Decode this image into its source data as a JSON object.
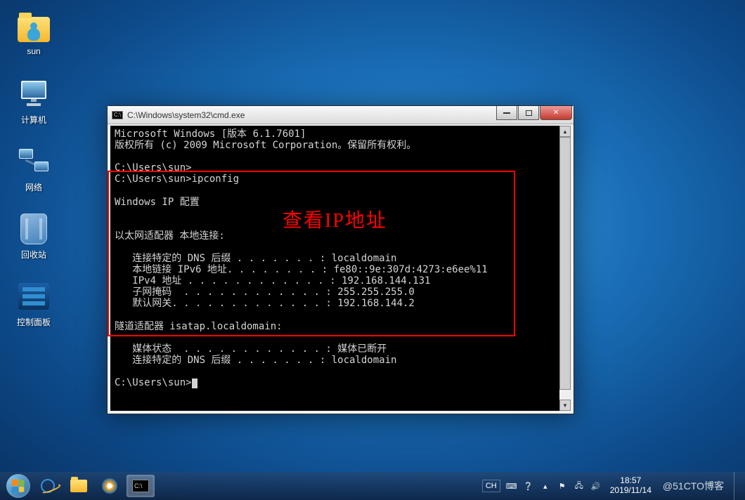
{
  "desktop": {
    "icons": [
      {
        "label": "sun"
      },
      {
        "label": "计算机"
      },
      {
        "label": "网络"
      },
      {
        "label": "回收站"
      },
      {
        "label": "控制面板"
      }
    ]
  },
  "cmd": {
    "title": "C:\\Windows\\system32\\cmd.exe",
    "icon_text": "C:\\",
    "lines": {
      "l1": "Microsoft Windows [版本 6.1.7601]",
      "l2": "版权所有 (c) 2009 Microsoft Corporation。保留所有权利。",
      "l3": "C:\\Users\\sun>",
      "l4": "C:\\Users\\sun>ipconfig",
      "l5": "Windows IP 配置",
      "l6": "以太网适配器 本地连接:",
      "l7": "   连接特定的 DNS 后缀 . . . . . . . : localdomain",
      "l8": "   本地链接 IPv6 地址. . . . . . . . : fe80::9e:307d:4273:e6ee%11",
      "l9": "   IPv4 地址 . . . . . . . . . . . . : 192.168.144.131",
      "l10": "   子网掩码  . . . . . . . . . . . . : 255.255.255.0",
      "l11": "   默认网关. . . . . . . . . . . . . : 192.168.144.2",
      "l12": "隧道适配器 isatap.localdomain:",
      "l13": "   媒体状态  . . . . . . . . . . . . : 媒体已断开",
      "l14": "   连接特定的 DNS 后缀 . . . . . . . : localdomain",
      "l15": "C:\\Users\\sun>"
    },
    "annotation": "查看IP地址"
  },
  "taskbar": {
    "lang": "CH",
    "time": "18:57",
    "date": "2019/11/14",
    "watermark": "@51CTO博客"
  }
}
